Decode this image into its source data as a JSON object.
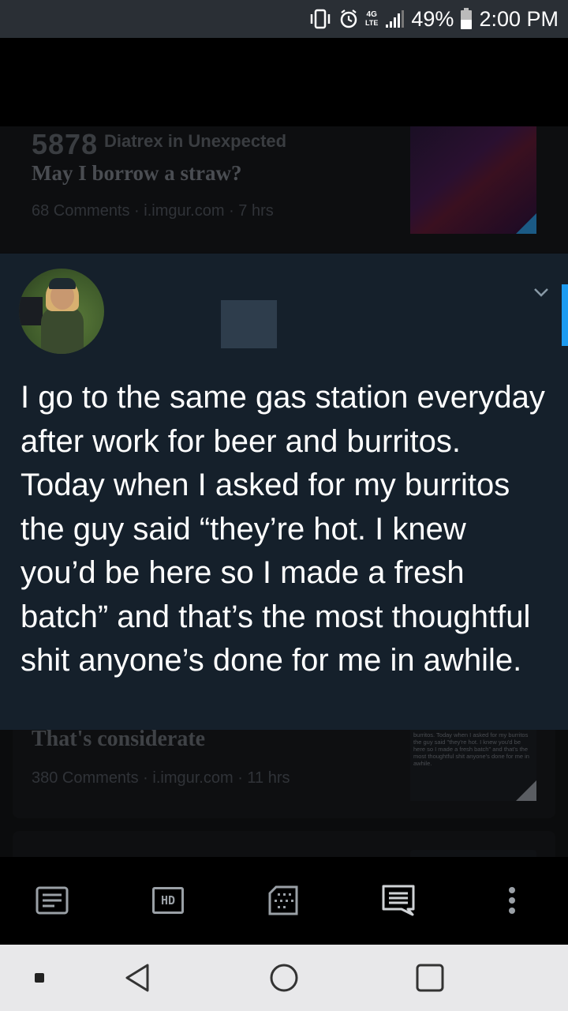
{
  "status_bar": {
    "network": "4G",
    "battery": "49%",
    "time": "2:00 PM"
  },
  "background_post": {
    "score": "5878",
    "user": "Diatrex in Unexpected",
    "title": "May I borrow a straw?",
    "info": "68 Comments · i.imgur.com · 7 hrs"
  },
  "tweet": {
    "text": "I go to the same gas station everyday after work for beer and burritos. Today when I asked for my burritos the guy said “they’re hot. I knew you’d be here so I made a fresh batch” and that’s the most thoughtful shit anyone’s done for me in awhile."
  },
  "second_post": {
    "title": "That's considerate",
    "info": "380 Comments · i.imgur.com · 11 hrs",
    "thumb_text": "burritos. Today when I asked for my burritos the guy said \"they're hot. I knew you'd be here so I made a fresh batch\" and that's the most thoughtful shit anyone's done for me in awhile."
  },
  "toolbar": {
    "items": [
      "article-icon",
      "hd-icon",
      "gallery-icon",
      "comments-icon",
      "more-icon"
    ],
    "hd_label": "HD"
  },
  "colors": {
    "tweet_bg": "#15202b",
    "accent": "#1d9bf0"
  }
}
